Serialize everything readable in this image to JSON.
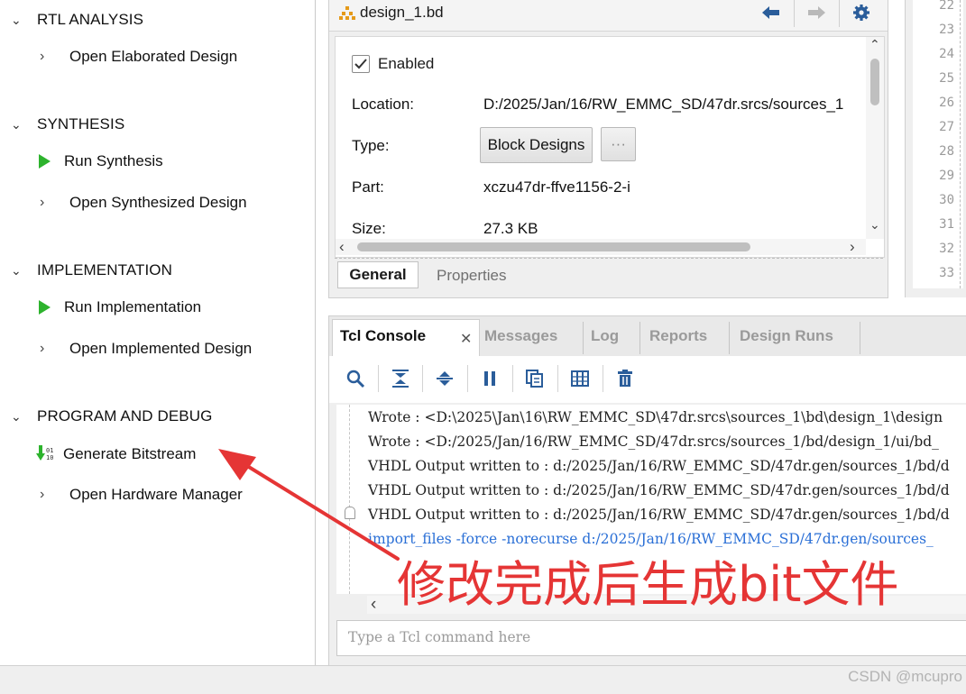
{
  "flow_navigator": {
    "sections": [
      {
        "title": "RTL ANALYSIS",
        "items": [
          {
            "label": "Open Elaborated Design"
          }
        ]
      },
      {
        "title": "SYNTHESIS",
        "items": [
          {
            "label": "Run Synthesis"
          },
          {
            "label": "Open Synthesized Design"
          }
        ]
      },
      {
        "title": "IMPLEMENTATION",
        "items": [
          {
            "label": "Run Implementation"
          },
          {
            "label": "Open Implemented Design"
          }
        ]
      },
      {
        "title": "PROGRAM AND DEBUG",
        "items": [
          {
            "label": "Generate Bitstream"
          },
          {
            "label": "Open Hardware Manager"
          }
        ]
      }
    ]
  },
  "properties": {
    "file_title": "design_1.bd",
    "enabled_label": "Enabled",
    "enabled_checked": true,
    "location_label": "Location:",
    "location_value": "D:/2025/Jan/16/RW_EMMC_SD/47dr.srcs/sources_1",
    "type_label": "Type:",
    "type_button": "Block Designs",
    "more_button": "···",
    "part_label": "Part:",
    "part_value": "xczu47dr-ffve1156-2-i",
    "size_label": "Size:",
    "size_value": "27.3 KB",
    "tabs": [
      "General",
      "Properties"
    ]
  },
  "code_view": {
    "line_numbers": [
      "22",
      "23",
      "24",
      "25",
      "26",
      "27",
      "28",
      "29",
      "30",
      "31",
      "32",
      "33"
    ]
  },
  "console": {
    "tabs": [
      "Tcl Console",
      "Messages",
      "Log",
      "Reports",
      "Design Runs"
    ],
    "log_lines": [
      "Wrote  : <D:\\2025\\Jan\\16\\RW_EMMC_SD\\47dr.srcs\\sources_1\\bd\\design_1\\design",
      "Wrote  : <D:/2025/Jan/16/RW_EMMC_SD/47dr.srcs/sources_1/bd/design_1/ui/bd_",
      "VHDL Output written to : d:/2025/Jan/16/RW_EMMC_SD/47dr.gen/sources_1/bd/d",
      "VHDL Output written to : d:/2025/Jan/16/RW_EMMC_SD/47dr.gen/sources_1/bd/d",
      "VHDL Output written to : d:/2025/Jan/16/RW_EMMC_SD/47dr.gen/sources_1/bd/d",
      "import_files -force -norecurse d:/2025/Jan/16/RW_EMMC_SD/47dr.gen/sources_"
    ],
    "command_placeholder": "Type a Tcl command here"
  },
  "annotation": {
    "text": "修改完成后生成bit文件",
    "color": "#e53535"
  },
  "watermark": "CSDN @mcupro",
  "colors": {
    "run_green": "#2db32d",
    "toolbar_blue": "#2a5d9a",
    "command_blue": "#2a6fd6",
    "annotation_red": "#e53535"
  }
}
